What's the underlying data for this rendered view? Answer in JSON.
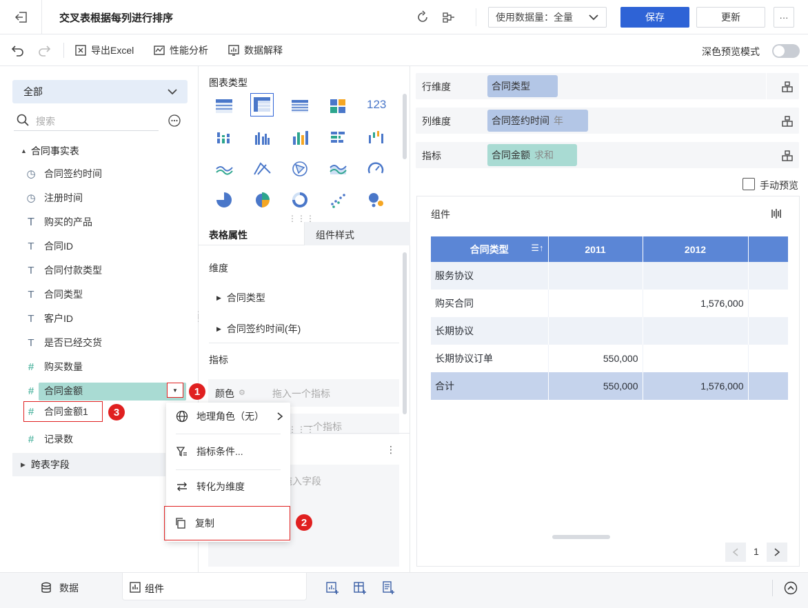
{
  "header": {
    "title": "交叉表根据每列进行排序",
    "data_usage": "使用数据量：全量",
    "save_label": "保存",
    "update_label": "更新",
    "more_label": "···"
  },
  "toolbar": {
    "export_label": "导出Excel",
    "perf_label": "性能分析",
    "explain_label": "数据解释",
    "dark_preview_label": "深色预览模式"
  },
  "left_panel": {
    "dataset_select": "全部",
    "search_placeholder": "搜索",
    "table_name": "合同事实表",
    "fields": [
      {
        "type": "time",
        "label": "合同签约时间"
      },
      {
        "type": "time",
        "label": "注册时间"
      },
      {
        "type": "text",
        "label": "购买的产品"
      },
      {
        "type": "text",
        "label": "合同ID"
      },
      {
        "type": "text",
        "label": "合同付款类型"
      },
      {
        "type": "text",
        "label": "合同类型"
      },
      {
        "type": "text",
        "label": "客户ID"
      },
      {
        "type": "text",
        "label": "是否已经交货"
      },
      {
        "type": "number",
        "label": "购买数量"
      },
      {
        "type": "number",
        "label": "合同金额"
      },
      {
        "type": "number",
        "label": "合同金额1"
      },
      {
        "type": "number",
        "label": "记录数"
      }
    ],
    "cross_table_label": "跨表字段"
  },
  "context_menu": {
    "items": [
      {
        "label": "地理角色（无）"
      },
      {
        "label": "指标条件..."
      },
      {
        "label": "转化为维度"
      },
      {
        "label": "复制"
      }
    ]
  },
  "badges": [
    "1",
    "2",
    "3"
  ],
  "mid_panel": {
    "chart_type_title": "图表类型",
    "number_chart_label": "123",
    "tabs": [
      "表格属性",
      "组件样式"
    ],
    "dimension_title": "维度",
    "dimensions": [
      "合同类型",
      "合同签约时间(年)"
    ],
    "measure_title": "指标",
    "color_label": "颜色",
    "drop_measure_placeholder": "拖入一个指标",
    "drop_measure_placeholder2": "一个指标",
    "drop_field_placeholder": "拖入字段"
  },
  "right_panel": {
    "row_dim_label": "行维度",
    "row_dim_value": "合同类型",
    "col_dim_label": "列维度",
    "col_dim_value": "合同签约时间",
    "col_dim_suffix": "年",
    "measure_label": "指标",
    "measure_value": "合同金额",
    "measure_suffix": "求和",
    "manual_preview_label": "手动预览",
    "component_title": "组件",
    "table": {
      "headers": [
        "合同类型",
        "2011",
        "2012"
      ],
      "rows": [
        [
          "服务协议",
          "",
          ""
        ],
        [
          "购买合同",
          "",
          "1,576,000"
        ],
        [
          "长期协议",
          "",
          ""
        ],
        [
          "长期协议订单",
          "550,000",
          ""
        ],
        [
          "合计",
          "550,000",
          "1,576,000"
        ]
      ]
    },
    "page_number": "1"
  },
  "bottom_bar": {
    "data_tab": "数据",
    "component_tab": "组件"
  },
  "colors": {
    "primary": "#2e63d6",
    "table_header": "#5b86d6",
    "pill_blue": "#b3c6e6",
    "pill_green": "#a9dbd3",
    "highlight_red": "#e02020"
  }
}
